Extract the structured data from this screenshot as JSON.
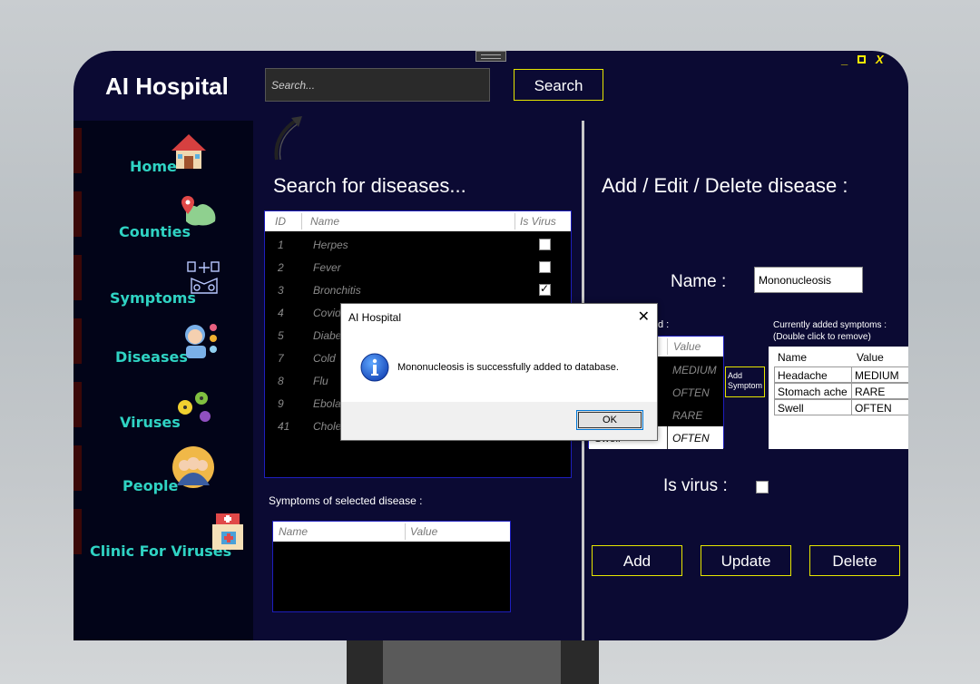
{
  "app": {
    "title": "AI Hospital"
  },
  "search": {
    "placeholder": "Search...",
    "button_label": "Search"
  },
  "window_controls": {
    "minimize": "_",
    "close": "X"
  },
  "sidebar": {
    "items": [
      {
        "label": "Home",
        "icon": "house-icon"
      },
      {
        "label": "Counties",
        "icon": "map-pin-icon"
      },
      {
        "label": "Symptoms",
        "icon": "medical-symptoms-icon"
      },
      {
        "label": "Diseases",
        "icon": "sick-person-icon"
      },
      {
        "label": "Viruses",
        "icon": "virus-icon"
      },
      {
        "label": "People",
        "icon": "people-group-icon"
      },
      {
        "label": "Clinic For Viruses",
        "icon": "clinic-icon"
      }
    ]
  },
  "left_panel": {
    "title": "Search for diseases...",
    "columns": [
      "ID",
      "Name",
      "Is Virus"
    ],
    "rows": [
      {
        "id": "1",
        "name": "Herpes",
        "is_virus": false
      },
      {
        "id": "2",
        "name": "Fever",
        "is_virus": false
      },
      {
        "id": "3",
        "name": "Bronchitis",
        "is_virus": true
      },
      {
        "id": "4",
        "name": "Covid",
        "is_virus": true
      },
      {
        "id": "5",
        "name": "Diabe",
        "is_virus": false
      },
      {
        "id": "7",
        "name": "Cold",
        "is_virus": true
      },
      {
        "id": "8",
        "name": "Flu",
        "is_virus": true
      },
      {
        "id": "9",
        "name": "Ebola",
        "is_virus": true
      },
      {
        "id": "41",
        "name": "Chole",
        "is_virus": false
      }
    ],
    "symptoms_label": "Symptoms of selected disease :",
    "symptoms_columns": [
      "Name",
      "Value"
    ]
  },
  "right_panel": {
    "title": "Add / Edit / Delete disease :",
    "name_label": "Name :",
    "name_value": "Mononucleosis",
    "available_label_fragment": "d :",
    "available_columns": [
      "Value"
    ],
    "available_rows": [
      {
        "name": "",
        "value": "MEDIUM"
      },
      {
        "name": "i",
        "value": "OFTEN"
      },
      {
        "name": "e",
        "value": "RARE"
      },
      {
        "name": "Swell",
        "value": "OFTEN"
      }
    ],
    "add_symptom_label": "Add Symptom",
    "current_label_line1": "Currently added symptoms :",
    "current_label_line2": "(Double click to remove)",
    "current_columns": [
      "Name",
      "Value"
    ],
    "current_rows": [
      {
        "name": "Headache",
        "value": "MEDIUM"
      },
      {
        "name": "Stomach ache",
        "value": "RARE"
      },
      {
        "name": "Swell",
        "value": "OFTEN"
      }
    ],
    "is_virus_label": "Is virus :",
    "is_virus_checked": false,
    "buttons": {
      "add": "Add",
      "update": "Update",
      "delete": "Delete"
    }
  },
  "dialog": {
    "title": "AI Hospital",
    "message": "Mononucleosis is successfully added to database.",
    "ok_label": "OK",
    "close_glyph": "✕",
    "icon": "info-icon"
  },
  "colors": {
    "window_bg": "#0b0a33",
    "sidebar_bg": "#020418",
    "accent_yellow": "#e6e600",
    "nav_text": "#2fd3c3",
    "nav_marker": "#3b0808"
  }
}
